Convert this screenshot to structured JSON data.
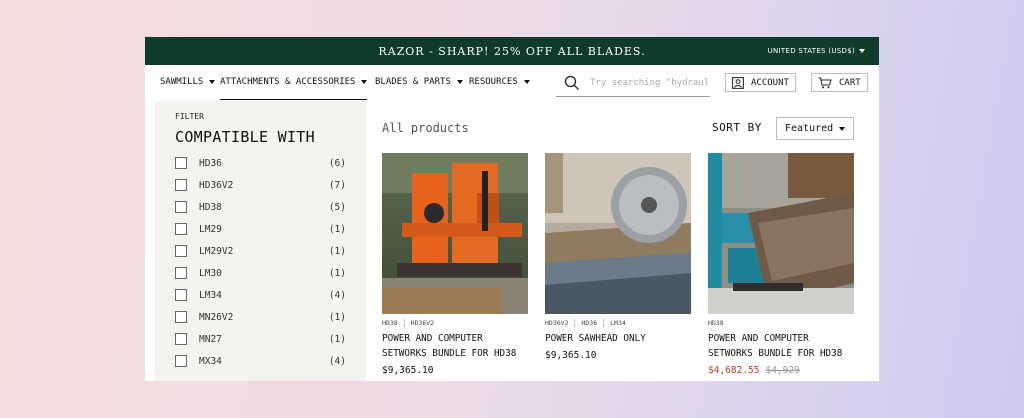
{
  "announcement": {
    "message": "RAZOR - SHARP! 25% OFF ALL BLADES.",
    "country": "UNITED STATES (USD$)"
  },
  "nav": {
    "items": [
      {
        "label": "SAWMILLS"
      },
      {
        "label": "ATTACHMENTS & ACCESSORIES"
      },
      {
        "label": "BLADES & PARTS"
      },
      {
        "label": "RESOURCES"
      }
    ],
    "search_placeholder": "Try searching \"hydraulics\"",
    "account_label": "ACCOUNT",
    "cart_label": "CART"
  },
  "sidebar": {
    "filter_label": "FILTER",
    "filter_title": "COMPATIBLE WITH",
    "options": [
      {
        "name": "HD36",
        "count": "(6)"
      },
      {
        "name": "HD36V2",
        "count": "(7)"
      },
      {
        "name": "HD38",
        "count": "(5)"
      },
      {
        "name": "LM29",
        "count": "(1)"
      },
      {
        "name": "LM29V2",
        "count": "(1)"
      },
      {
        "name": "LM30",
        "count": "(1)"
      },
      {
        "name": "LM34",
        "count": "(4)"
      },
      {
        "name": "MN26V2",
        "count": "(1)"
      },
      {
        "name": "MN27",
        "count": "(1)"
      },
      {
        "name": "MX34",
        "count": "(4)"
      }
    ]
  },
  "main": {
    "heading": "All products",
    "sort_label": "SORT BY",
    "sort_value": "Featured",
    "products": [
      {
        "tags": [
          "HD38",
          "HD36V2"
        ],
        "title": "POWER AND COMPUTER SETWORKS BUNDLE FOR HD38",
        "price": "$9,365.10"
      },
      {
        "tags": [
          "HD36V2",
          "HD36",
          "LM34"
        ],
        "title": "POWER SAWHEAD ONLY",
        "price": "$9,365.10"
      },
      {
        "tags": [
          "HD38"
        ],
        "title": "POWER AND COMPUTER SETWORKS BUNDLE FOR HD38",
        "sale_price": "$4,682.55",
        "original_price": "$4,929"
      }
    ]
  },
  "colors": {
    "header_bg": "#0f3b2d",
    "sale": "#c0392b",
    "sidebar_bg": "#f4f3ef"
  }
}
